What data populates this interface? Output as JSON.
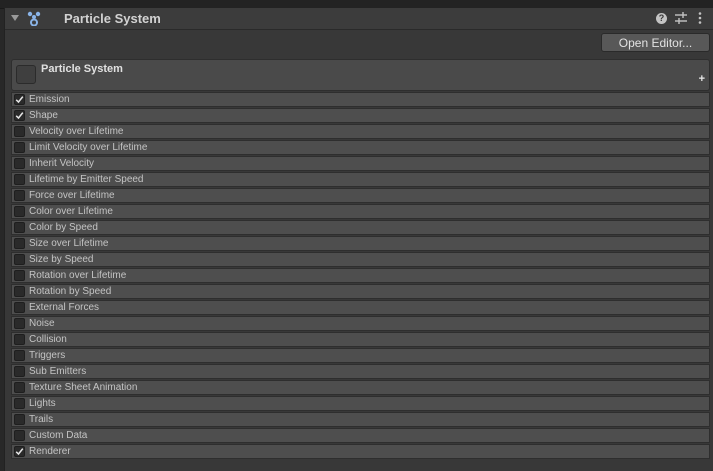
{
  "header": {
    "title": "Particle System",
    "icons": [
      "fold-arrow-icon",
      "particle-system-icon",
      "help-icon",
      "preset-icon",
      "kebab-menu-icon"
    ]
  },
  "toolbar": {
    "open_editor_label": "Open Editor..."
  },
  "main_module": {
    "label": "Particle System",
    "add_label": "+"
  },
  "modules": [
    {
      "label": "Emission",
      "checked": true
    },
    {
      "label": "Shape",
      "checked": true
    },
    {
      "label": "Velocity over Lifetime",
      "checked": false
    },
    {
      "label": "Limit Velocity over Lifetime",
      "checked": false
    },
    {
      "label": "Inherit Velocity",
      "checked": false
    },
    {
      "label": "Lifetime by Emitter Speed",
      "checked": false
    },
    {
      "label": "Force over Lifetime",
      "checked": false
    },
    {
      "label": "Color over Lifetime",
      "checked": false
    },
    {
      "label": "Color by Speed",
      "checked": false
    },
    {
      "label": "Size over Lifetime",
      "checked": false
    },
    {
      "label": "Size by Speed",
      "checked": false
    },
    {
      "label": "Rotation over Lifetime",
      "checked": false
    },
    {
      "label": "Rotation by Speed",
      "checked": false
    },
    {
      "label": "External Forces",
      "checked": false
    },
    {
      "label": "Noise",
      "checked": false
    },
    {
      "label": "Collision",
      "checked": false
    },
    {
      "label": "Triggers",
      "checked": false
    },
    {
      "label": "Sub Emitters",
      "checked": false
    },
    {
      "label": "Texture Sheet Animation",
      "checked": false
    },
    {
      "label": "Lights",
      "checked": false
    },
    {
      "label": "Trails",
      "checked": false
    },
    {
      "label": "Custom Data",
      "checked": false
    },
    {
      "label": "Renderer",
      "checked": true
    }
  ],
  "colors": {
    "panel_bg": "#383838",
    "row_bg": "#4e4e4e",
    "accent_icon": "#8ab4e8"
  }
}
